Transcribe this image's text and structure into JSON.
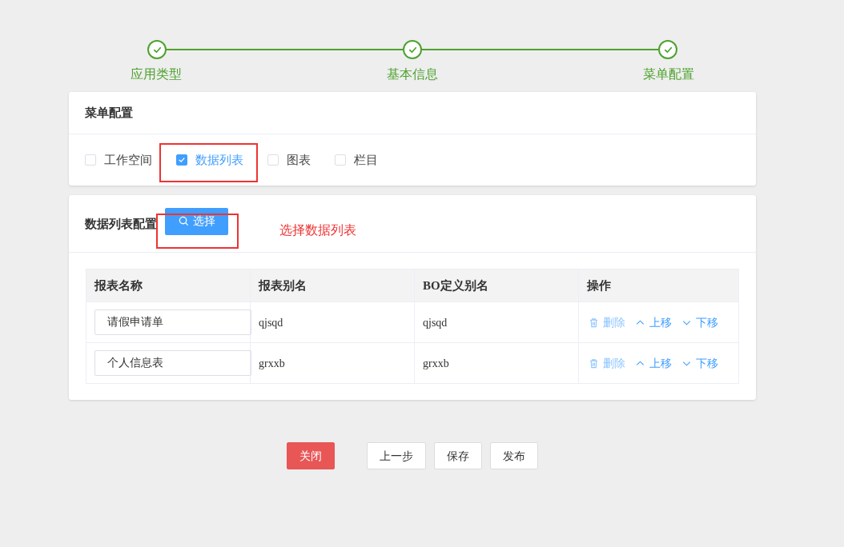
{
  "steps": [
    {
      "label": "应用类型",
      "done": true
    },
    {
      "label": "基本信息",
      "done": true
    },
    {
      "label": "菜单配置",
      "done": true
    }
  ],
  "menu_config": {
    "title": "菜单配置",
    "options": [
      {
        "label": "工作空间",
        "checked": false
      },
      {
        "label": "数据列表",
        "checked": true
      },
      {
        "label": "图表",
        "checked": false
      },
      {
        "label": "栏目",
        "checked": false
      }
    ]
  },
  "list_config": {
    "title": "数据列表配置",
    "select_button": "选择",
    "annotation": "选择数据列表",
    "table": {
      "columns": [
        "报表名称",
        "报表别名",
        "BO定义别名",
        "操作"
      ],
      "rows": [
        {
          "name": "请假申请单",
          "alias": "qjsqd",
          "bo_alias": "qjsqd",
          "actions": [
            "删除",
            "上移",
            "下移"
          ]
        },
        {
          "name": "个人信息表",
          "alias": "grxxb",
          "bo_alias": "grxxb",
          "actions": [
            "删除",
            "上移",
            "下移"
          ]
        }
      ]
    }
  },
  "buttons": [
    {
      "label": "关闭",
      "kind": "danger"
    },
    {
      "label": "上一步",
      "kind": "default"
    },
    {
      "label": "保存",
      "kind": "default"
    },
    {
      "label": "发布",
      "kind": "default"
    }
  ]
}
